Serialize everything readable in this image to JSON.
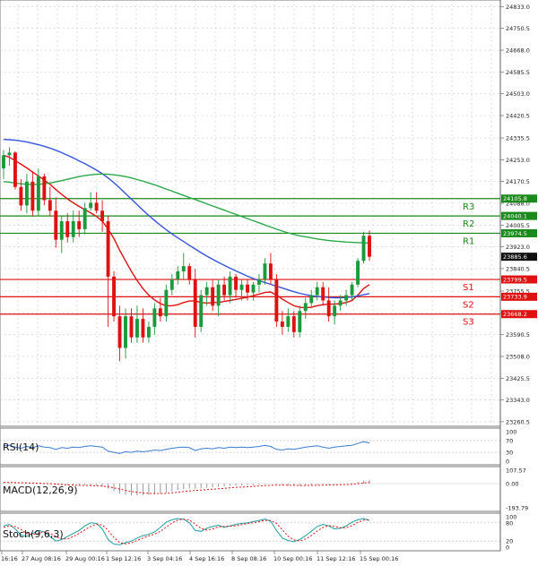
{
  "chart_data": {
    "type": "candlestick",
    "price_axis": {
      "ticks": [
        "24833.0",
        "24750.5",
        "24668.0",
        "24585.5",
        "24503.0",
        "24420.5",
        "24335.5",
        "24253.0",
        "24170.5",
        "24088.0",
        "24005.5",
        "23923.0",
        "23840.5",
        "23755.5",
        "23673.0",
        "23590.5",
        "23508.0",
        "23425.5",
        "23343.0",
        "23260.5"
      ],
      "ylim": [
        23250,
        24848
      ]
    },
    "x_labels": [
      "16:16",
      "27 Aug 08:16",
      "29 Aug 00:16",
      "1 Sep 12:16",
      "3 Sep 04:16",
      "4 Sep 16:16",
      "8 Sep 08:16",
      "10 Sep 00:16",
      "11 Sep 12:16",
      "15 Sep 00:16"
    ],
    "levels": [
      {
        "name": "R3",
        "value": 24105.8,
        "label": "24105.8",
        "color": "#1a8a1a"
      },
      {
        "name": "R2",
        "value": 24040.1,
        "label": "24040.1",
        "color": "#1a8a1a"
      },
      {
        "name": "R1",
        "value": 23974.5,
        "label": "23974.5",
        "color": "#1a8a1a"
      },
      {
        "name": "S1",
        "value": 23799.5,
        "label": "23799.5",
        "color": "#e01010"
      },
      {
        "name": "S2",
        "value": 23733.9,
        "label": "23733.9",
        "color": "#e01010"
      },
      {
        "name": "S3",
        "value": 23668.2,
        "label": "23668.2",
        "color": "#e01010"
      }
    ],
    "current_price": {
      "value": 23885.6,
      "label": "23885.6"
    },
    "candles": [
      {
        "o": 24220,
        "h": 24290,
        "l": 24180,
        "c": 24270
      },
      {
        "o": 24270,
        "h": 24300,
        "l": 24230,
        "c": 24280
      },
      {
        "o": 24280,
        "h": 24285,
        "l": 24140,
        "c": 24150
      },
      {
        "o": 24150,
        "h": 24180,
        "l": 24060,
        "c": 24080
      },
      {
        "o": 24080,
        "h": 24200,
        "l": 24050,
        "c": 24170
      },
      {
        "o": 24170,
        "h": 24210,
        "l": 24040,
        "c": 24060
      },
      {
        "o": 24060,
        "h": 24220,
        "l": 24040,
        "c": 24190
      },
      {
        "o": 24190,
        "h": 24200,
        "l": 24080,
        "c": 24100
      },
      {
        "o": 24100,
        "h": 24150,
        "l": 24040,
        "c": 24060
      },
      {
        "o": 24060,
        "h": 24110,
        "l": 23920,
        "c": 23950
      },
      {
        "o": 23950,
        "h": 24040,
        "l": 23900,
        "c": 24020
      },
      {
        "o": 24020,
        "h": 24050,
        "l": 23940,
        "c": 23960
      },
      {
        "o": 23960,
        "h": 24060,
        "l": 23940,
        "c": 24020
      },
      {
        "o": 24020,
        "h": 24060,
        "l": 23960,
        "c": 23990
      },
      {
        "o": 23990,
        "h": 24090,
        "l": 23970,
        "c": 24070
      },
      {
        "o": 24070,
        "h": 24130,
        "l": 24060,
        "c": 24090
      },
      {
        "o": 24090,
        "h": 24130,
        "l": 24050,
        "c": 24060
      },
      {
        "o": 24060,
        "h": 24100,
        "l": 23980,
        "c": 24020
      },
      {
        "o": 24020,
        "h": 24040,
        "l": 23620,
        "c": 23810
      },
      {
        "o": 23810,
        "h": 23830,
        "l": 23640,
        "c": 23660
      },
      {
        "o": 23660,
        "h": 23700,
        "l": 23490,
        "c": 23540
      },
      {
        "o": 23540,
        "h": 23690,
        "l": 23500,
        "c": 23660
      },
      {
        "o": 23660,
        "h": 23690,
        "l": 23560,
        "c": 23580
      },
      {
        "o": 23580,
        "h": 23700,
        "l": 23560,
        "c": 23650
      },
      {
        "o": 23650,
        "h": 23690,
        "l": 23560,
        "c": 23580
      },
      {
        "o": 23580,
        "h": 23640,
        "l": 23560,
        "c": 23620
      },
      {
        "o": 23620,
        "h": 23710,
        "l": 23590,
        "c": 23690
      },
      {
        "o": 23690,
        "h": 23730,
        "l": 23640,
        "c": 23660
      },
      {
        "o": 23660,
        "h": 23780,
        "l": 23640,
        "c": 23760
      },
      {
        "o": 23760,
        "h": 23820,
        "l": 23740,
        "c": 23800
      },
      {
        "o": 23800,
        "h": 23850,
        "l": 23780,
        "c": 23830
      },
      {
        "o": 23830,
        "h": 23900,
        "l": 23800,
        "c": 23850
      },
      {
        "o": 23850,
        "h": 23860,
        "l": 23780,
        "c": 23800
      },
      {
        "o": 23800,
        "h": 23840,
        "l": 23580,
        "c": 23620
      },
      {
        "o": 23620,
        "h": 23760,
        "l": 23600,
        "c": 23740
      },
      {
        "o": 23740,
        "h": 23790,
        "l": 23700,
        "c": 23770
      },
      {
        "o": 23770,
        "h": 23800,
        "l": 23680,
        "c": 23700
      },
      {
        "o": 23700,
        "h": 23800,
        "l": 23660,
        "c": 23780
      },
      {
        "o": 23780,
        "h": 23810,
        "l": 23720,
        "c": 23740
      },
      {
        "o": 23740,
        "h": 23830,
        "l": 23710,
        "c": 23810
      },
      {
        "o": 23810,
        "h": 23820,
        "l": 23730,
        "c": 23760
      },
      {
        "o": 23760,
        "h": 23800,
        "l": 23720,
        "c": 23780
      },
      {
        "o": 23780,
        "h": 23800,
        "l": 23720,
        "c": 23750
      },
      {
        "o": 23750,
        "h": 23790,
        "l": 23720,
        "c": 23780
      },
      {
        "o": 23780,
        "h": 23820,
        "l": 23750,
        "c": 23800
      },
      {
        "o": 23800,
        "h": 23880,
        "l": 23780,
        "c": 23860
      },
      {
        "o": 23860,
        "h": 23900,
        "l": 23780,
        "c": 23800
      },
      {
        "o": 23800,
        "h": 23820,
        "l": 23620,
        "c": 23640
      },
      {
        "o": 23640,
        "h": 23680,
        "l": 23590,
        "c": 23620
      },
      {
        "o": 23620,
        "h": 23690,
        "l": 23600,
        "c": 23660
      },
      {
        "o": 23660,
        "h": 23680,
        "l": 23580,
        "c": 23600
      },
      {
        "o": 23600,
        "h": 23700,
        "l": 23580,
        "c": 23680
      },
      {
        "o": 23680,
        "h": 23730,
        "l": 23650,
        "c": 23710
      },
      {
        "o": 23710,
        "h": 23760,
        "l": 23690,
        "c": 23740
      },
      {
        "o": 23740,
        "h": 23790,
        "l": 23720,
        "c": 23770
      },
      {
        "o": 23770,
        "h": 23790,
        "l": 23700,
        "c": 23720
      },
      {
        "o": 23720,
        "h": 23770,
        "l": 23640,
        "c": 23660
      },
      {
        "o": 23660,
        "h": 23720,
        "l": 23630,
        "c": 23700
      },
      {
        "o": 23700,
        "h": 23740,
        "l": 23680,
        "c": 23720
      },
      {
        "o": 23720,
        "h": 23760,
        "l": 23700,
        "c": 23740
      },
      {
        "o": 23740,
        "h": 23790,
        "l": 23720,
        "c": 23780
      },
      {
        "o": 23780,
        "h": 23880,
        "l": 23770,
        "c": 23870
      },
      {
        "o": 23870,
        "h": 23980,
        "l": 23860,
        "c": 23965
      },
      {
        "o": 23965,
        "h": 23985,
        "l": 23870,
        "c": 23885.6
      }
    ],
    "series": [
      {
        "name": "ma-fast",
        "color": "#e01010",
        "values": [
          24270,
          24262,
          24250,
          24236,
          24222,
          24206,
          24192,
          24176,
          24160,
          24140,
          24122,
          24105,
          24090,
          24076,
          24064,
          24052,
          24038,
          24020,
          23990,
          23955,
          23910,
          23870,
          23830,
          23795,
          23765,
          23740,
          23722,
          23708,
          23700,
          23700,
          23704,
          23712,
          23718,
          23718,
          23712,
          23710,
          23712,
          23712,
          23716,
          23720,
          23724,
          23728,
          23732,
          23738,
          23744,
          23750,
          23752,
          23740,
          23725,
          23712,
          23700,
          23694,
          23692,
          23694,
          23700,
          23704,
          23706,
          23706,
          23708,
          23712,
          23720,
          23740,
          23765,
          23780
        ]
      },
      {
        "name": "ma-mid",
        "color": "#3355dd",
        "values": [
          24330,
          24329,
          24327,
          24324,
          24320,
          24315,
          24310,
          24304,
          24297,
          24289,
          24280,
          24270,
          24260,
          24249,
          24238,
          24226,
          24214,
          24200,
          24184,
          24166,
          24146,
          24125,
          24104,
          24083,
          24062,
          24042,
          24023,
          24005,
          23988,
          23972,
          23957,
          23943,
          23929,
          23915,
          23901,
          23888,
          23876,
          23864,
          23853,
          23842,
          23832,
          23822,
          23812,
          23803,
          23795,
          23788,
          23781,
          23774,
          23767,
          23760,
          23753,
          23747,
          23742,
          23738,
          23735,
          23733,
          23731,
          23730,
          23730,
          23731,
          23733,
          23737,
          23742,
          23746
        ]
      },
      {
        "name": "ma-slow",
        "color": "#2aa84a",
        "values": [
          24170,
          24168,
          24165,
          24162,
          24160,
          24159,
          24160,
          24162,
          24165,
          24169,
          24174,
          24179,
          24184,
          24189,
          24193,
          24196,
          24198,
          24199,
          24198,
          24196,
          24193,
          24189,
          24184,
          24178,
          24172,
          24165,
          24158,
          24150,
          24142,
          24134,
          24126,
          24118,
          24110,
          24102,
          24094,
          24086,
          24078,
          24070,
          24062,
          24054,
          24046,
          24038,
          24030,
          24022,
          24014,
          24006,
          23998,
          23990,
          23983,
          23976,
          23970,
          23965,
          23961,
          23957,
          23953,
          23950,
          23947,
          23945,
          23943,
          23941,
          23940,
          23939,
          23938,
          23937
        ]
      }
    ],
    "rsi": {
      "label": "RSI(14)",
      "ticks": [
        "100",
        "70",
        "30",
        "0"
      ],
      "ylim": [
        0,
        100
      ],
      "values": [
        52,
        54,
        48,
        44,
        50,
        46,
        52,
        48,
        46,
        40,
        46,
        44,
        48,
        46,
        50,
        52,
        50,
        48,
        34,
        30,
        26,
        32,
        30,
        34,
        32,
        34,
        38,
        36,
        40,
        44,
        46,
        48,
        46,
        36,
        42,
        44,
        42,
        46,
        44,
        48,
        46,
        48,
        46,
        48,
        50,
        54,
        50,
        40,
        38,
        42,
        40,
        44,
        48,
        50,
        52,
        48,
        44,
        48,
        50,
        52,
        54,
        60,
        66,
        62
      ]
    },
    "macd": {
      "label": "MACD(12,26,9)",
      "ticks": [
        "107.57",
        "0.00",
        "-193.79"
      ],
      "ylim": [
        -193.79,
        107.57
      ],
      "histogram": [
        5,
        5,
        4,
        2,
        2,
        0,
        0,
        -2,
        -4,
        -8,
        -10,
        -12,
        -12,
        -12,
        -12,
        -12,
        -14,
        -20,
        -40,
        -60,
        -80,
        -90,
        -95,
        -95,
        -92,
        -90,
        -85,
        -80,
        -72,
        -62,
        -52,
        -44,
        -38,
        -40,
        -38,
        -34,
        -30,
        -26,
        -22,
        -18,
        -16,
        -14,
        -12,
        -10,
        -8,
        -4,
        0,
        -6,
        -12,
        -16,
        -18,
        -18,
        -16,
        -12,
        -8,
        -6,
        -6,
        -4,
        -2,
        0,
        4,
        12,
        24,
        30
      ],
      "signal": [
        10,
        9,
        8,
        7,
        6,
        4,
        3,
        1,
        -1,
        -4,
        -7,
        -10,
        -12,
        -14,
        -15,
        -16,
        -17,
        -20,
        -26,
        -34,
        -44,
        -54,
        -63,
        -70,
        -75,
        -78,
        -80,
        -80,
        -78,
        -74,
        -69,
        -64,
        -59,
        -55,
        -52,
        -48,
        -45,
        -41,
        -38,
        -34,
        -31,
        -28,
        -25,
        -22,
        -19,
        -16,
        -13,
        -12,
        -12,
        -13,
        -14,
        -15,
        -15,
        -14,
        -13,
        -12,
        -11,
        -10,
        -9,
        -7,
        -5,
        -1,
        4,
        9
      ]
    },
    "stoch": {
      "label": "Stoch(9,6,3)",
      "ticks": [
        "100",
        "80",
        "20",
        "0"
      ],
      "ylim": [
        0,
        100
      ],
      "k": [
        70,
        75,
        60,
        40,
        35,
        45,
        55,
        50,
        35,
        20,
        25,
        35,
        45,
        55,
        70,
        80,
        78,
        60,
        25,
        10,
        8,
        15,
        20,
        30,
        38,
        42,
        50,
        65,
        82,
        90,
        94,
        92,
        80,
        55,
        52,
        62,
        68,
        72,
        65,
        70,
        75,
        78,
        80,
        84,
        88,
        92,
        85,
        55,
        30,
        22,
        18,
        25,
        38,
        52,
        68,
        75,
        70,
        60,
        62,
        70,
        82,
        90,
        94,
        88
      ],
      "d": [
        65,
        70,
        68,
        58,
        45,
        42,
        45,
        50,
        46,
        35,
        27,
        27,
        35,
        45,
        57,
        68,
        76,
        73,
        55,
        32,
        15,
        11,
        14,
        22,
        30,
        37,
        43,
        52,
        66,
        79,
        89,
        92,
        89,
        76,
        62,
        56,
        60,
        67,
        68,
        69,
        70,
        74,
        78,
        80,
        84,
        88,
        88,
        78,
        57,
        36,
        24,
        21,
        27,
        38,
        53,
        65,
        71,
        68,
        64,
        64,
        71,
        81,
        89,
        90
      ]
    }
  }
}
